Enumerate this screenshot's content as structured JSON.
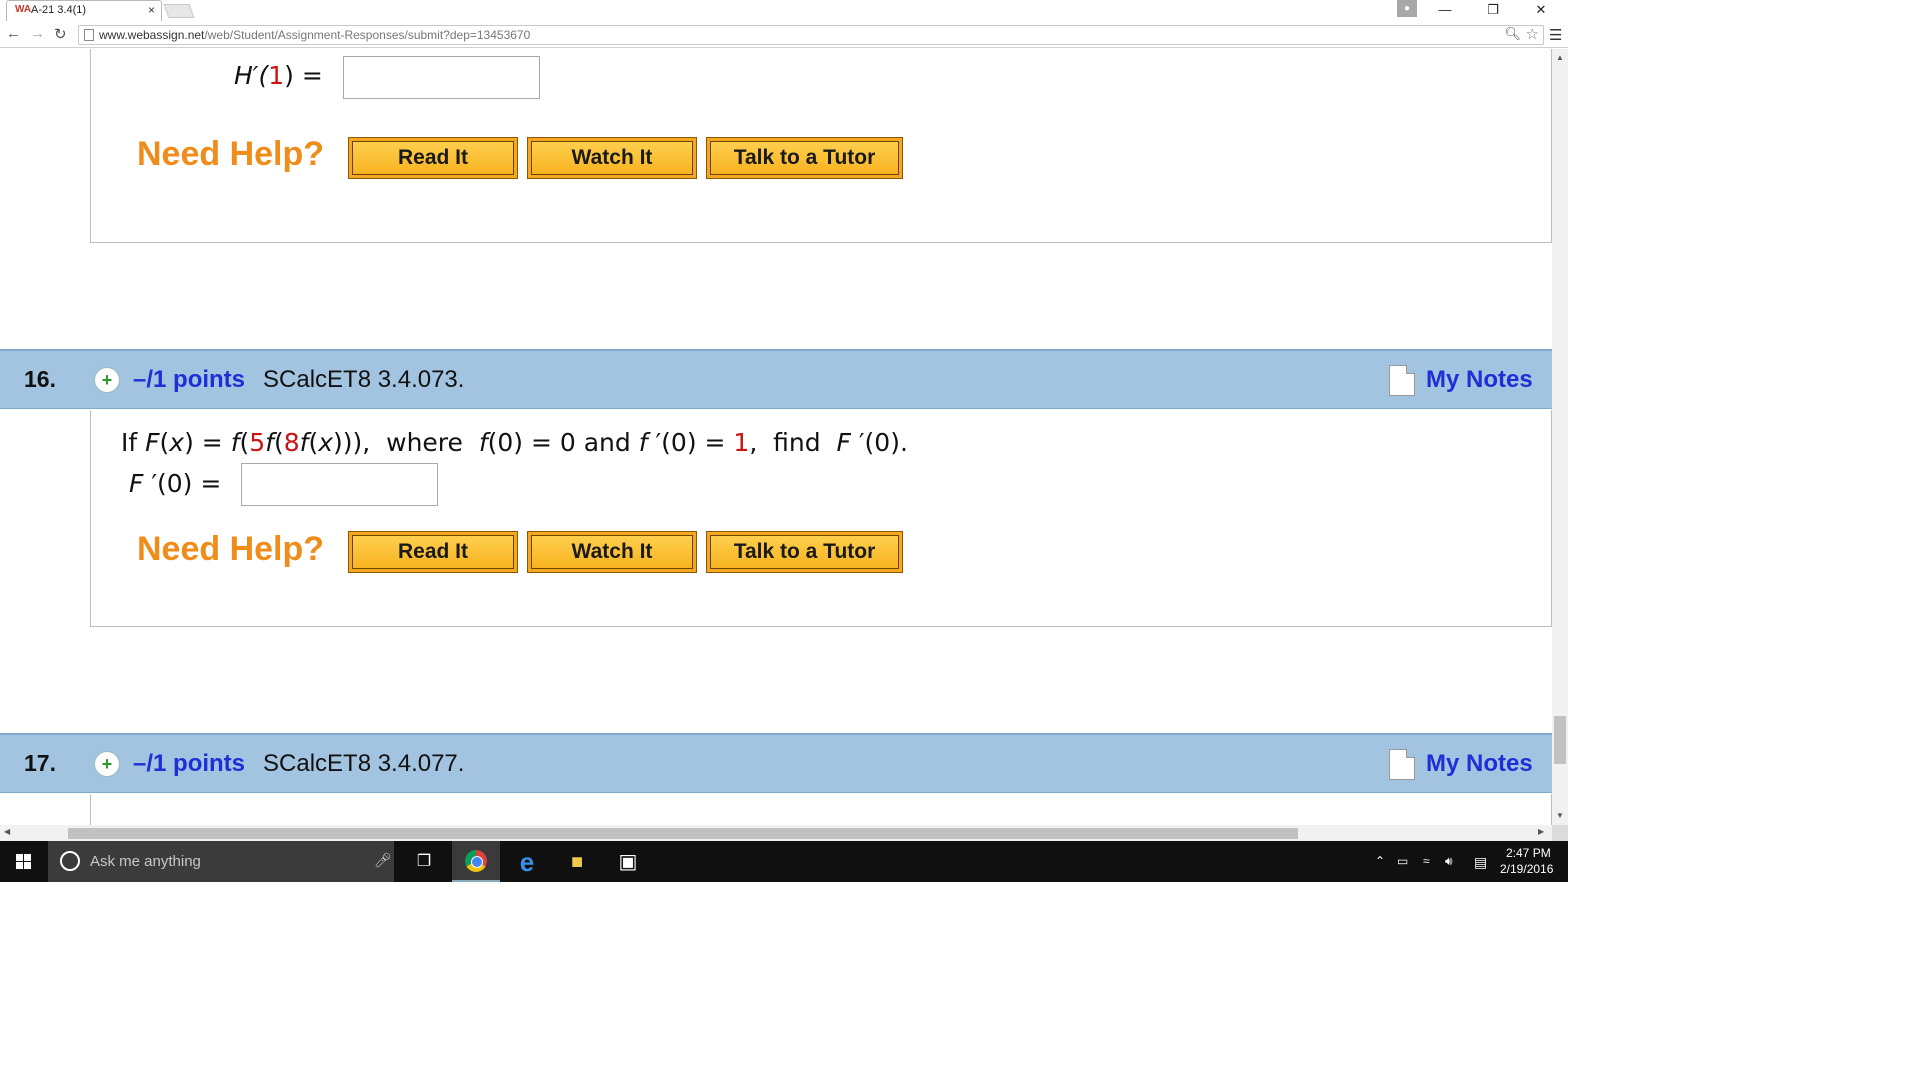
{
  "browser": {
    "tab_title": "A-21 3.4(1)",
    "tab_favicon": "WA",
    "tab_close": "×",
    "url_host": "www.webassign.net",
    "url_path": "/web/Student/Assignment-Responses/submit?dep=13453670"
  },
  "prev_question": {
    "answer_label": "H′(1) =",
    "answer_lhs": "H′(",
    "answer_arg": "1",
    "answer_rhs": ") =",
    "need_help": "Need Help?",
    "buttons": [
      "Read It",
      "Watch It",
      "Talk to a Tutor"
    ]
  },
  "q16": {
    "number": "16.",
    "points": "–/1 points",
    "id": "SCalcET8 3.4.073.",
    "notes": "My Notes",
    "stmt": {
      "p1": "If ",
      "p2": "F",
      "p3": "(",
      "p4": "x",
      "p5": ") = ",
      "p6": "f",
      "p7": "(",
      "p8": "5",
      "p9": "f",
      "p10": "(",
      "p11": "8",
      "p12": "f",
      "p13": "(",
      "p14": "x",
      "p15": "))),  where  ",
      "p16": "f",
      "p17": "(0) = 0 and ",
      "p18": "f",
      "p19": " ′(0) = ",
      "p20": "1",
      "p21": ",  find  ",
      "p22": "F",
      "p23": " ′(0)."
    },
    "answer_lhs": "F",
    "answer_rhs": " ′(0) =",
    "need_help": "Need Help?",
    "buttons": [
      "Read It",
      "Watch It",
      "Talk to a Tutor"
    ]
  },
  "q17": {
    "number": "17.",
    "points": "–/1 points",
    "id": "SCalcET8 3.4.077.",
    "notes": "My Notes"
  },
  "taskbar": {
    "search_placeholder": "Ask me anything",
    "time": "2:47 PM",
    "date": "2/19/2016"
  },
  "colors": {
    "header_bg": "#a3c4e0",
    "link_blue": "#1d2fd6",
    "need_help_orange": "#f08c1a",
    "button_gold": "#f7b321",
    "red_value": "#cc1111"
  },
  "icons": [
    "back-arrow-icon",
    "forward-arrow-icon",
    "reload-icon",
    "page-icon",
    "zoom-icon",
    "star-icon",
    "menu-icon",
    "plus-icon",
    "notes-icon",
    "windows-start-icon",
    "cortana-icon",
    "microphone-icon",
    "task-view-icon",
    "chrome-icon",
    "edge-icon",
    "file-explorer-icon",
    "store-icon"
  ]
}
